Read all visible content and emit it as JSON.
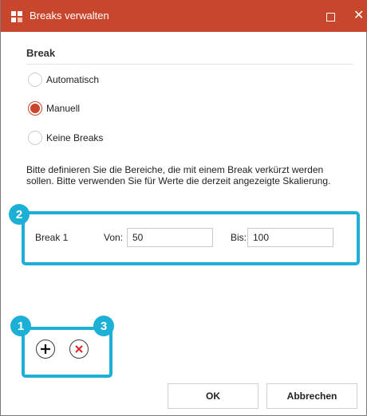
{
  "window": {
    "title": "Breaks verwalten",
    "accent_color": "#c8462c",
    "close_glyph": "✕"
  },
  "break_section": {
    "title": "Break",
    "options": [
      {
        "label": "Automatisch",
        "selected": false
      },
      {
        "label": "Manuell",
        "selected": true
      },
      {
        "label": "Keine Breaks",
        "selected": false
      }
    ]
  },
  "description": "Bitte definieren Sie die Bereiche, die mit einem Break verkürzt werden sollen. Bitte verwenden Sie für Werte die derzeit angezeigte Skalierung.",
  "break_row": {
    "name": "Break 1",
    "from_label": "Von:",
    "from_value": "50",
    "to_label": "Bis:",
    "to_value": "100"
  },
  "annotations": {
    "badge_1": "1",
    "badge_2": "2",
    "badge_3": "3",
    "highlight_color": "#1cb0d6"
  },
  "actions": {
    "add_icon": "plus-icon",
    "remove_icon": "close-red-icon"
  },
  "footer": {
    "ok_label": "OK",
    "cancel_label": "Abbrechen"
  }
}
